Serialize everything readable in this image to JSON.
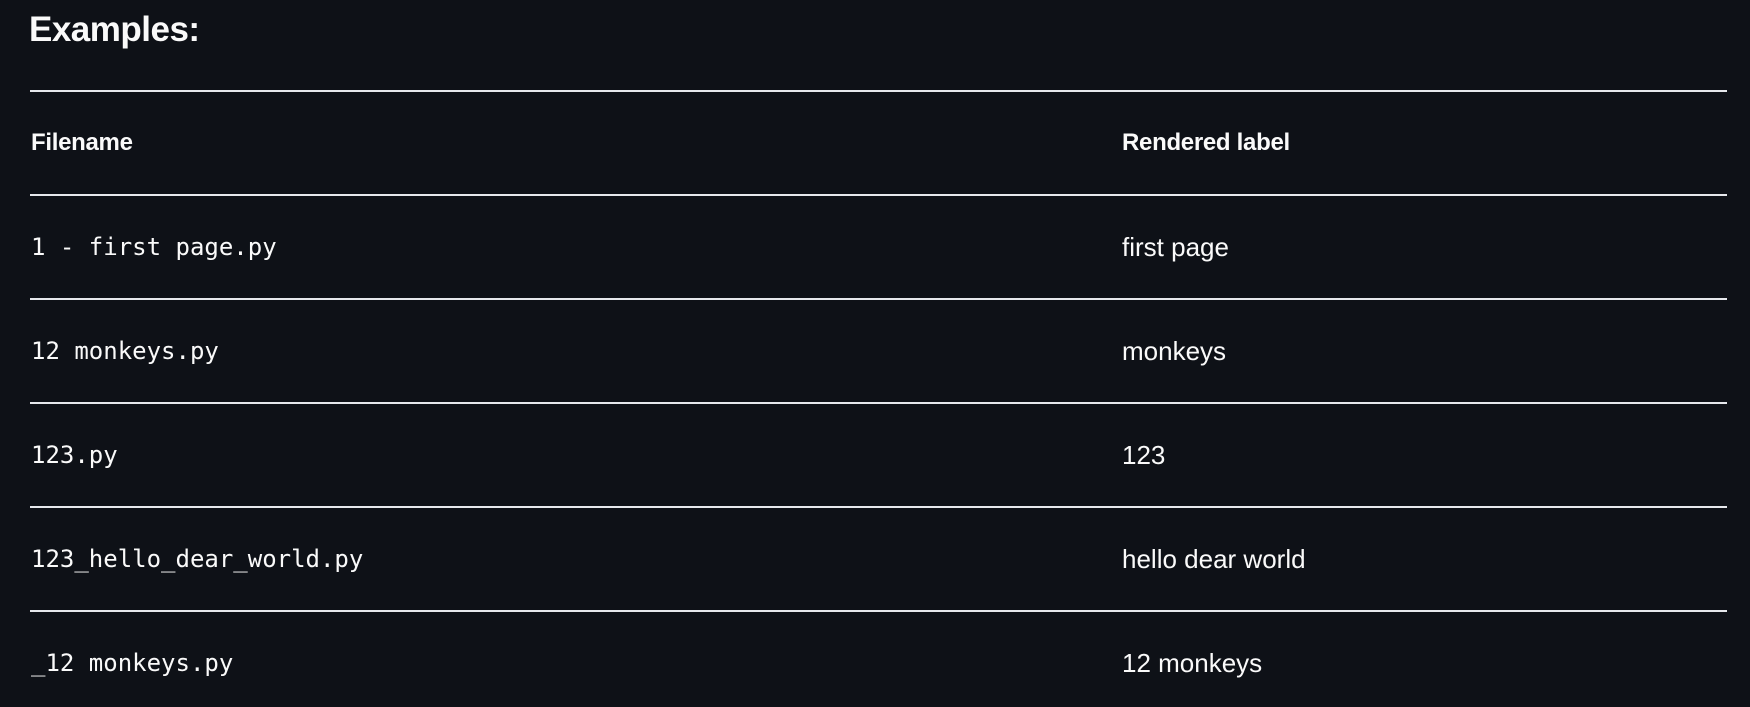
{
  "heading": "Examples:",
  "table": {
    "headers": [
      "Filename",
      "Rendered label"
    ],
    "rows": [
      {
        "filename": "1 - first page.py",
        "label": "first page"
      },
      {
        "filename": "12 monkeys.py",
        "label": "monkeys"
      },
      {
        "filename": "123.py",
        "label": "123"
      },
      {
        "filename": "123_hello_dear_world.py",
        "label": "hello dear world"
      },
      {
        "filename": "_12 monkeys.py",
        "label": "12 monkeys"
      }
    ]
  },
  "colors": {
    "background": "#0e1117",
    "text": "#fafafa",
    "rule": "#e6e8ec"
  }
}
